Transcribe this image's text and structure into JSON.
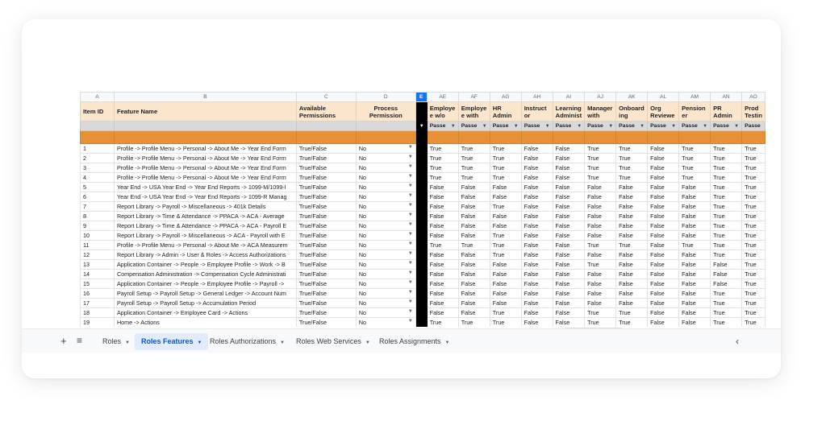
{
  "columns": {
    "letters": [
      "A",
      "B",
      "C",
      "D",
      "E",
      "AE",
      "AF",
      "AG",
      "AH",
      "AI",
      "AJ",
      "AK",
      "AL",
      "AM",
      "AN",
      "AO"
    ],
    "headers": [
      "Item ID",
      "Feature Name",
      "Available Permissions",
      "Process Permission",
      "",
      "Employe e w/o",
      "Employe e with",
      "HR Admin",
      "Instruct or",
      "Learning Administ",
      "Manager with",
      "Onboard ing",
      "Org Reviewe",
      "Pension er",
      "PR Admin",
      "Prod Testin"
    ],
    "filter_value": "Passe"
  },
  "rows": [
    {
      "id": "1",
      "feature": "Profile -> Profile Menu -> Personal -> About Me -> Year End Form",
      "perm": "True/False",
      "proc": "No",
      "vals": [
        "True",
        "True",
        "True",
        "False",
        "False",
        "True",
        "True",
        "False",
        "True",
        "True",
        "True"
      ]
    },
    {
      "id": "2",
      "feature": "Profile -> Profile Menu -> Personal -> About Me -> Year End Form",
      "perm": "True/False",
      "proc": "No",
      "vals": [
        "True",
        "True",
        "True",
        "False",
        "False",
        "True",
        "True",
        "False",
        "True",
        "True",
        "True"
      ]
    },
    {
      "id": "3",
      "feature": "Profile -> Profile Menu -> Personal -> About Me -> Year End Form",
      "perm": "True/False",
      "proc": "No",
      "vals": [
        "True",
        "True",
        "True",
        "False",
        "False",
        "True",
        "True",
        "False",
        "True",
        "True",
        "True"
      ]
    },
    {
      "id": "4",
      "feature": "Profile -> Profile Menu -> Personal -> About Me -> Year End Form",
      "perm": "True/False",
      "proc": "No",
      "vals": [
        "True",
        "True",
        "True",
        "False",
        "False",
        "True",
        "True",
        "False",
        "True",
        "True",
        "True"
      ]
    },
    {
      "id": "5",
      "feature": "Year End -> USA Year End -> Year End Reports -> 1099-M/1099-I",
      "perm": "True/False",
      "proc": "No",
      "vals": [
        "False",
        "False",
        "False",
        "False",
        "False",
        "False",
        "False",
        "False",
        "False",
        "True",
        "True"
      ]
    },
    {
      "id": "6",
      "feature": "Year End -> USA Year End -> Year End Reports -> 1099-R Manag",
      "perm": "True/False",
      "proc": "No",
      "vals": [
        "False",
        "False",
        "False",
        "False",
        "False",
        "False",
        "False",
        "False",
        "False",
        "True",
        "True"
      ]
    },
    {
      "id": "7",
      "feature": "Report Library -> Payroll -> Miscellaneous -> 401k Details",
      "perm": "True/False",
      "proc": "No",
      "vals": [
        "False",
        "False",
        "True",
        "False",
        "False",
        "False",
        "False",
        "False",
        "False",
        "True",
        "True"
      ]
    },
    {
      "id": "8",
      "feature": "Report Library -> Time & Attendance -> PPACA -> ACA - Average",
      "perm": "True/False",
      "proc": "No",
      "vals": [
        "False",
        "False",
        "False",
        "False",
        "False",
        "False",
        "False",
        "False",
        "False",
        "True",
        "True"
      ]
    },
    {
      "id": "9",
      "feature": "Report Library -> Time & Attendance -> PPACA -> ACA - Payroll E",
      "perm": "True/False",
      "proc": "No",
      "vals": [
        "False",
        "False",
        "False",
        "False",
        "False",
        "False",
        "False",
        "False",
        "False",
        "True",
        "True"
      ]
    },
    {
      "id": "10",
      "feature": "Report Library -> Payroll -> Miscellaneous -> ACA - Payroll with E",
      "perm": "True/False",
      "proc": "No",
      "vals": [
        "False",
        "False",
        "True",
        "False",
        "False",
        "False",
        "False",
        "False",
        "False",
        "True",
        "True"
      ]
    },
    {
      "id": "11",
      "feature": "Profile -> Profile Menu -> Personal -> About Me -> ACA Measurem",
      "perm": "True/False",
      "proc": "No",
      "vals": [
        "True",
        "True",
        "True",
        "False",
        "False",
        "True",
        "True",
        "False",
        "True",
        "True",
        "True"
      ]
    },
    {
      "id": "12",
      "feature": "Report Library -> Admin -> User & Roles -> Access Authorizations",
      "perm": "True/False",
      "proc": "No",
      "vals": [
        "False",
        "False",
        "True",
        "False",
        "False",
        "False",
        "False",
        "False",
        "False",
        "True",
        "True"
      ]
    },
    {
      "id": "13",
      "feature": "Application Container -> People -> Employee Profile -> Work -> B",
      "perm": "True/False",
      "proc": "No",
      "vals": [
        "False",
        "False",
        "False",
        "False",
        "False",
        "True",
        "False",
        "False",
        "False",
        "False",
        "True"
      ]
    },
    {
      "id": "14",
      "feature": "Compensation Administration -> Compensation Cycle Administrati",
      "perm": "True/False",
      "proc": "No",
      "vals": [
        "False",
        "False",
        "False",
        "False",
        "False",
        "False",
        "False",
        "False",
        "False",
        "False",
        "True"
      ]
    },
    {
      "id": "15",
      "feature": "Application Container -> People -> Employee Profile -> Payroll ->",
      "perm": "True/False",
      "proc": "No",
      "vals": [
        "False",
        "False",
        "False",
        "False",
        "False",
        "False",
        "False",
        "False",
        "False",
        "False",
        "True"
      ]
    },
    {
      "id": "16",
      "feature": "Payroll Setup -> Payroll Setup -> General Ledger -> Account Num",
      "perm": "True/False",
      "proc": "No",
      "vals": [
        "False",
        "False",
        "False",
        "False",
        "False",
        "False",
        "False",
        "False",
        "False",
        "True",
        "True"
      ]
    },
    {
      "id": "17",
      "feature": "Payroll Setup -> Payroll Setup -> Accumulation Period",
      "perm": "True/False",
      "proc": "No",
      "vals": [
        "False",
        "False",
        "False",
        "False",
        "False",
        "False",
        "False",
        "False",
        "False",
        "True",
        "True"
      ]
    },
    {
      "id": "18",
      "feature": "Application Container -> Employee Card -> Actions",
      "perm": "True/False",
      "proc": "No",
      "vals": [
        "False",
        "False",
        "True",
        "False",
        "False",
        "True",
        "True",
        "False",
        "False",
        "True",
        "True"
      ]
    },
    {
      "id": "19",
      "feature": "Home -> Actions",
      "perm": "True/False",
      "proc": "No",
      "vals": [
        "True",
        "True",
        "True",
        "False",
        "False",
        "True",
        "True",
        "False",
        "False",
        "True",
        "True"
      ]
    }
  ],
  "tabs": [
    {
      "label": "Roles",
      "active": false
    },
    {
      "label": "Roles Features",
      "active": true
    },
    {
      "label": "Roles Authorizations",
      "active": false
    },
    {
      "label": "Roles Web Services",
      "active": false
    },
    {
      "label": "Roles Assignments",
      "active": false
    }
  ],
  "toolbar": {
    "add": "+",
    "menu": "≡",
    "scroll_left": "‹"
  },
  "icons": {
    "add": "plus-icon",
    "menu": "all-sheets-icon",
    "dropdown": "dropdown-arrow-icon",
    "scroll": "chevron-left-icon"
  },
  "colors": {
    "header_fill": "#fce5cd",
    "band_fill": "#e69138",
    "filter_fill": "#d9d9d9",
    "active_tab": "#e1ebfa",
    "selected_col": "#1a73e8"
  }
}
